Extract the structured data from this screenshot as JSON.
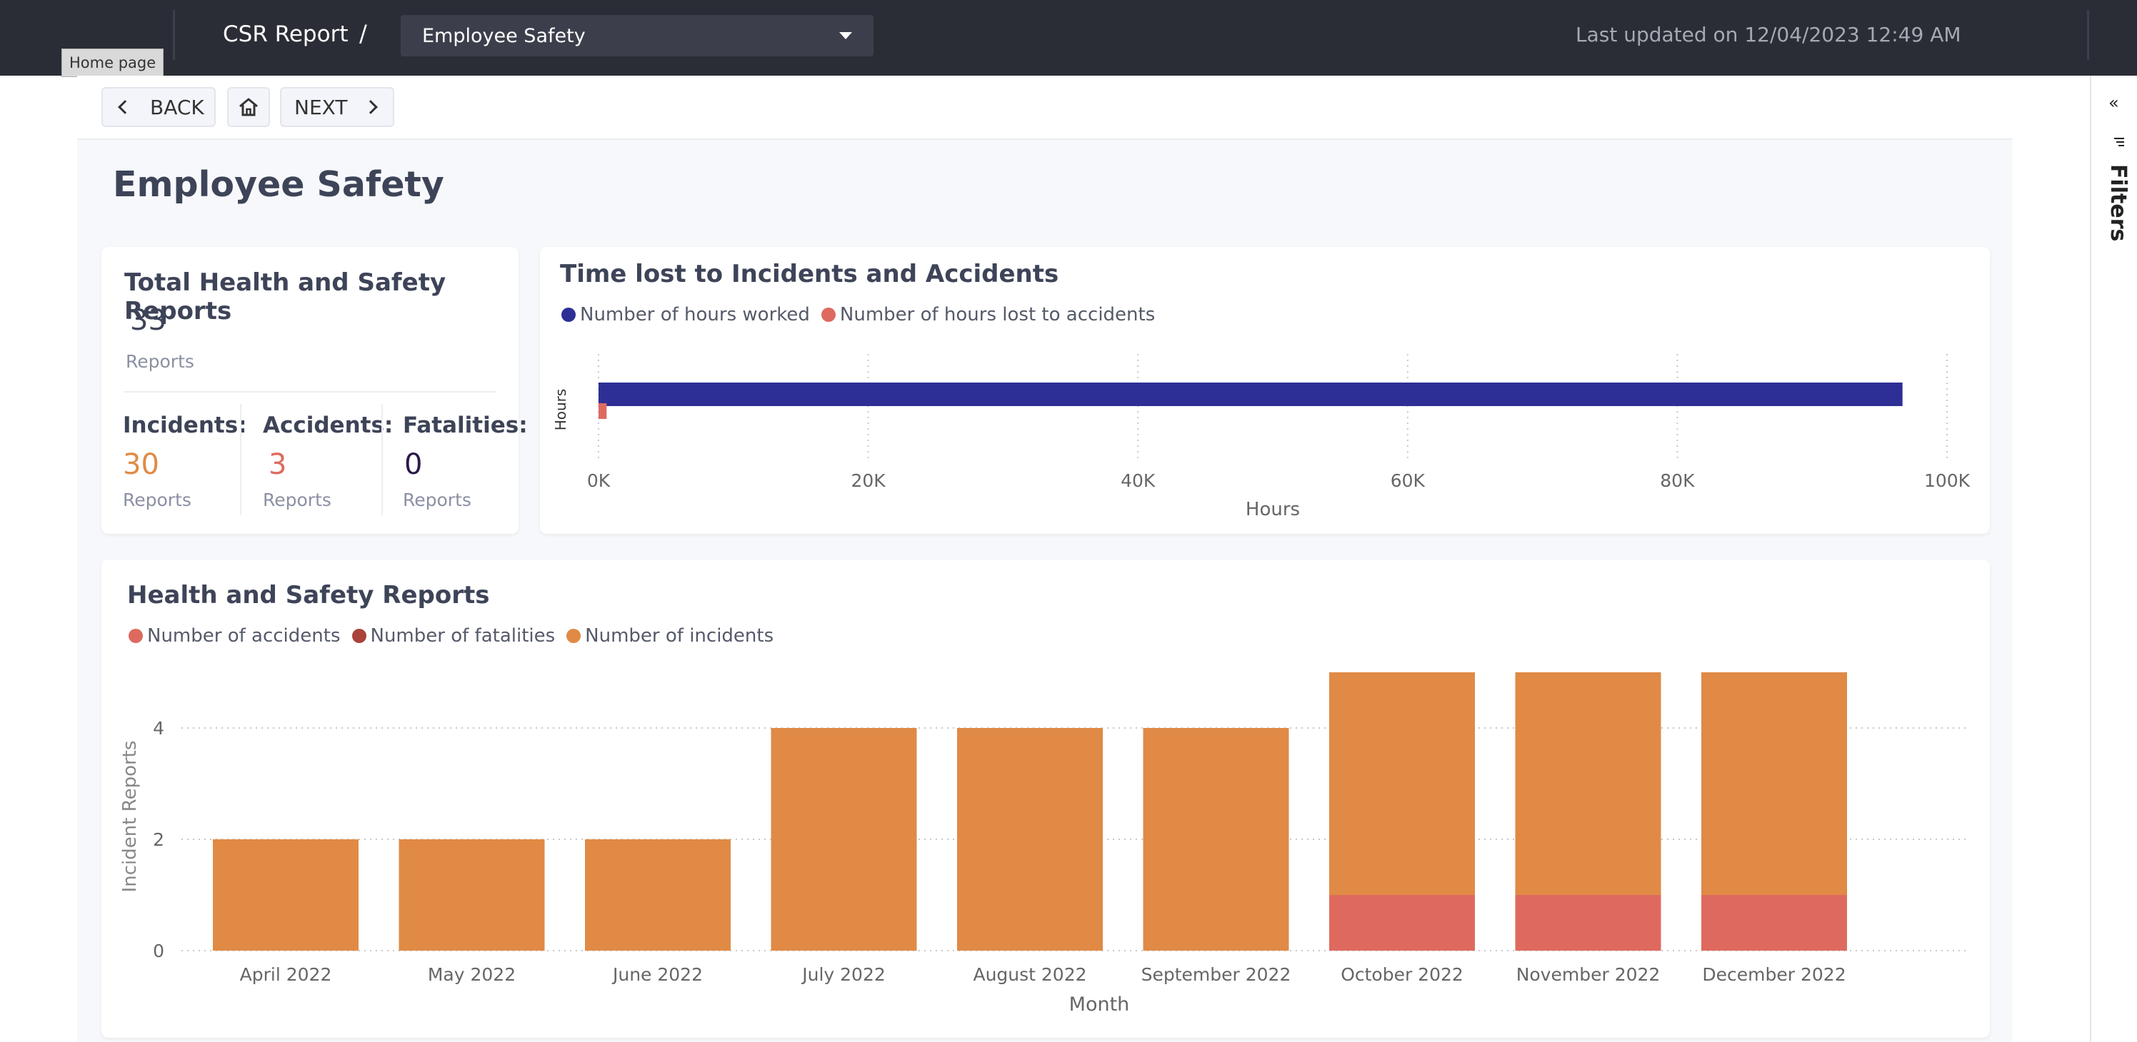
{
  "header": {
    "report_name": "CSR Report",
    "separator": "/",
    "selected_page": "Employee Safety",
    "last_updated": "Last updated on 12/04/2023 12:49 AM",
    "tooltip": "Home page"
  },
  "nav": {
    "back_label": "BACK",
    "next_label": "NEXT"
  },
  "filters": {
    "label": "Filters"
  },
  "page": {
    "title": "Employee Safety"
  },
  "kpi": {
    "title": "Total Health and Safety Reports",
    "total_value": "33",
    "total_unit": "Reports",
    "incidents_label": "Incidents:",
    "incidents_value": "30",
    "incidents_unit": "Reports",
    "accidents_label": "Accidents:",
    "accidents_value": "3",
    "accidents_unit": "Reports",
    "fatalities_label": "Fatalities:",
    "fatalities_value": "0",
    "fatalities_unit": "Reports",
    "colors": {
      "incidents": "#e08a45",
      "accidents": "#de6a5f",
      "fatalities": "#2b1a4a"
    }
  },
  "chart_data": [
    {
      "type": "bar",
      "orientation": "horizontal",
      "title": "Time lost to Incidents and Accidents",
      "categories": [
        "Hours"
      ],
      "series": [
        {
          "name": "Number of hours worked",
          "values": [
            96700
          ],
          "color": "#2e2f96"
        },
        {
          "name": "Number of hours lost to accidents",
          "values": [
            600
          ],
          "color": "#de6a5f"
        }
      ],
      "xlabel": "Hours",
      "ylabel": "Hours",
      "xlim": [
        0,
        100000
      ],
      "xticks": [
        "0K",
        "20K",
        "40K",
        "60K",
        "80K",
        "100K"
      ],
      "grid": true,
      "legend": "top-left"
    },
    {
      "type": "bar",
      "stacked": true,
      "title": "Health and Safety Reports",
      "categories": [
        "April 2022",
        "May 2022",
        "June 2022",
        "July 2022",
        "August 2022",
        "September 2022",
        "October 2022",
        "November 2022",
        "December 2022"
      ],
      "series": [
        {
          "name": "Number of accidents",
          "values": [
            0,
            0,
            0,
            0,
            0,
            0,
            1,
            1,
            1
          ],
          "color": "#de6a5f"
        },
        {
          "name": "Number of fatalities",
          "values": [
            0,
            0,
            0,
            0,
            0,
            0,
            0,
            0,
            0
          ],
          "color": "#a8423a"
        },
        {
          "name": "Number of incidents",
          "values": [
            2,
            2,
            2,
            4,
            4,
            4,
            4,
            4,
            4
          ],
          "color": "#e08a45"
        }
      ],
      "xlabel": "Month",
      "ylabel": "Incident Reports",
      "ylim": [
        0,
        5
      ],
      "yticks": [
        "0",
        "2",
        "4"
      ],
      "grid": true,
      "legend": "top-left"
    }
  ]
}
